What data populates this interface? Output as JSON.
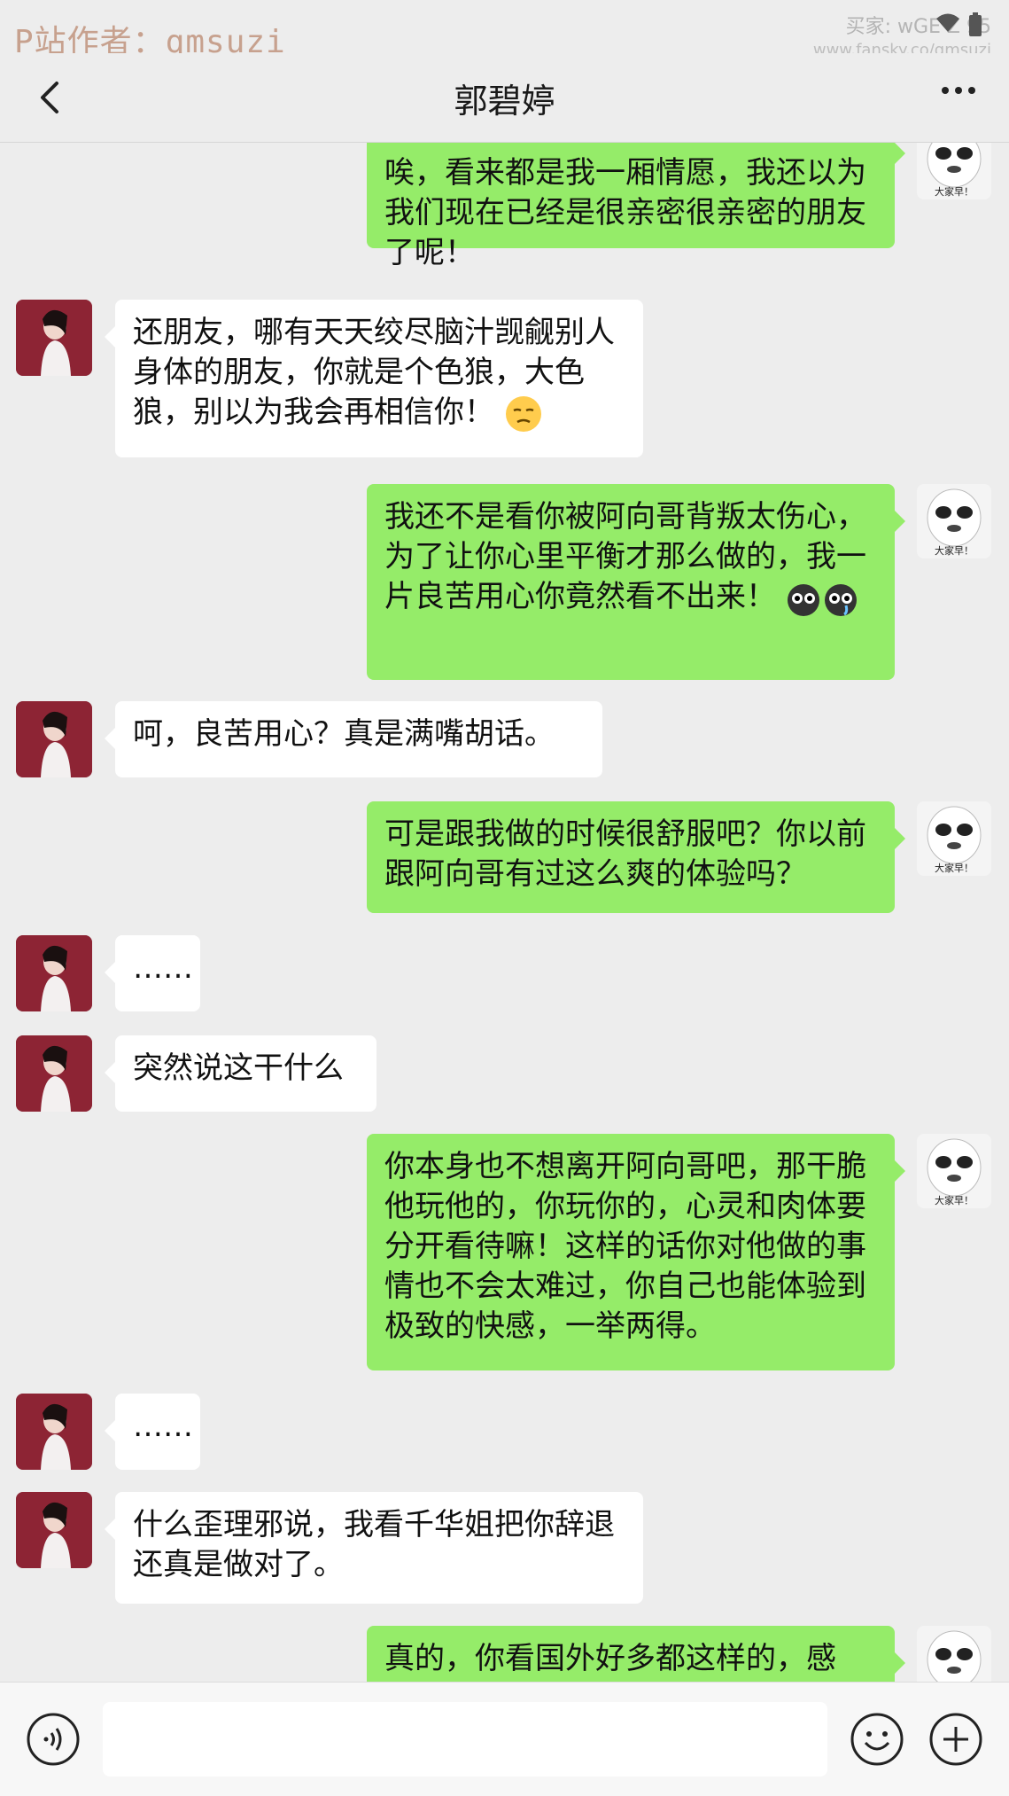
{
  "watermark": "P站作者：qmsuzi",
  "buyer": "买家: wGE   Z  95",
  "site": "www.fansky.co/qmsuzi",
  "chat_title": "郭碧婷",
  "avatar_right_text": "大家早！",
  "messages": [
    {
      "side": "out",
      "text": "唉，看来都是我一厢情愿，我还以为我们现在已经是很亲密很亲密的朋友了呢！"
    },
    {
      "side": "in",
      "text": "还朋友，哪有天天绞尽脑汁觊觎别人身体的朋友，你就是个色狼，大色狼，别以为我会再相信你！",
      "emoji": "unamused-emoji-icon"
    },
    {
      "side": "out",
      "text": "我还不是看你被阿向哥背叛太伤心，为了让你心里平衡才那么做的，我一片良苦用心你竟然看不出来！",
      "emoji": "crying-eyes-emoji-icon"
    },
    {
      "side": "in",
      "text": "呵，良苦用心？真是满嘴胡话。"
    },
    {
      "side": "out",
      "text": "可是跟我做的时候很舒服吧？你以前跟阿向哥有过这么爽的体验吗？"
    },
    {
      "side": "in",
      "text": "……"
    },
    {
      "side": "in",
      "text": "突然说这干什么"
    },
    {
      "side": "out",
      "text": "你本身也不想离开阿向哥吧，那干脆他玩他的，你玩你的，心灵和肉体要分开看待嘛！这样的话你对他做的事情也不会太难过，你自己也能体验到极致的快感，一举两得。"
    },
    {
      "side": "in",
      "text": "……"
    },
    {
      "side": "in",
      "text": "什么歪理邪说，我看千华姐把你辞退还真是做对了。"
    },
    {
      "side": "out",
      "text": "真的，你看国外好多都这样的，感"
    }
  ],
  "colors": {
    "outgoing_bubble": "#95ec69",
    "incoming_bubble": "#ffffff",
    "background": "#ededed"
  }
}
